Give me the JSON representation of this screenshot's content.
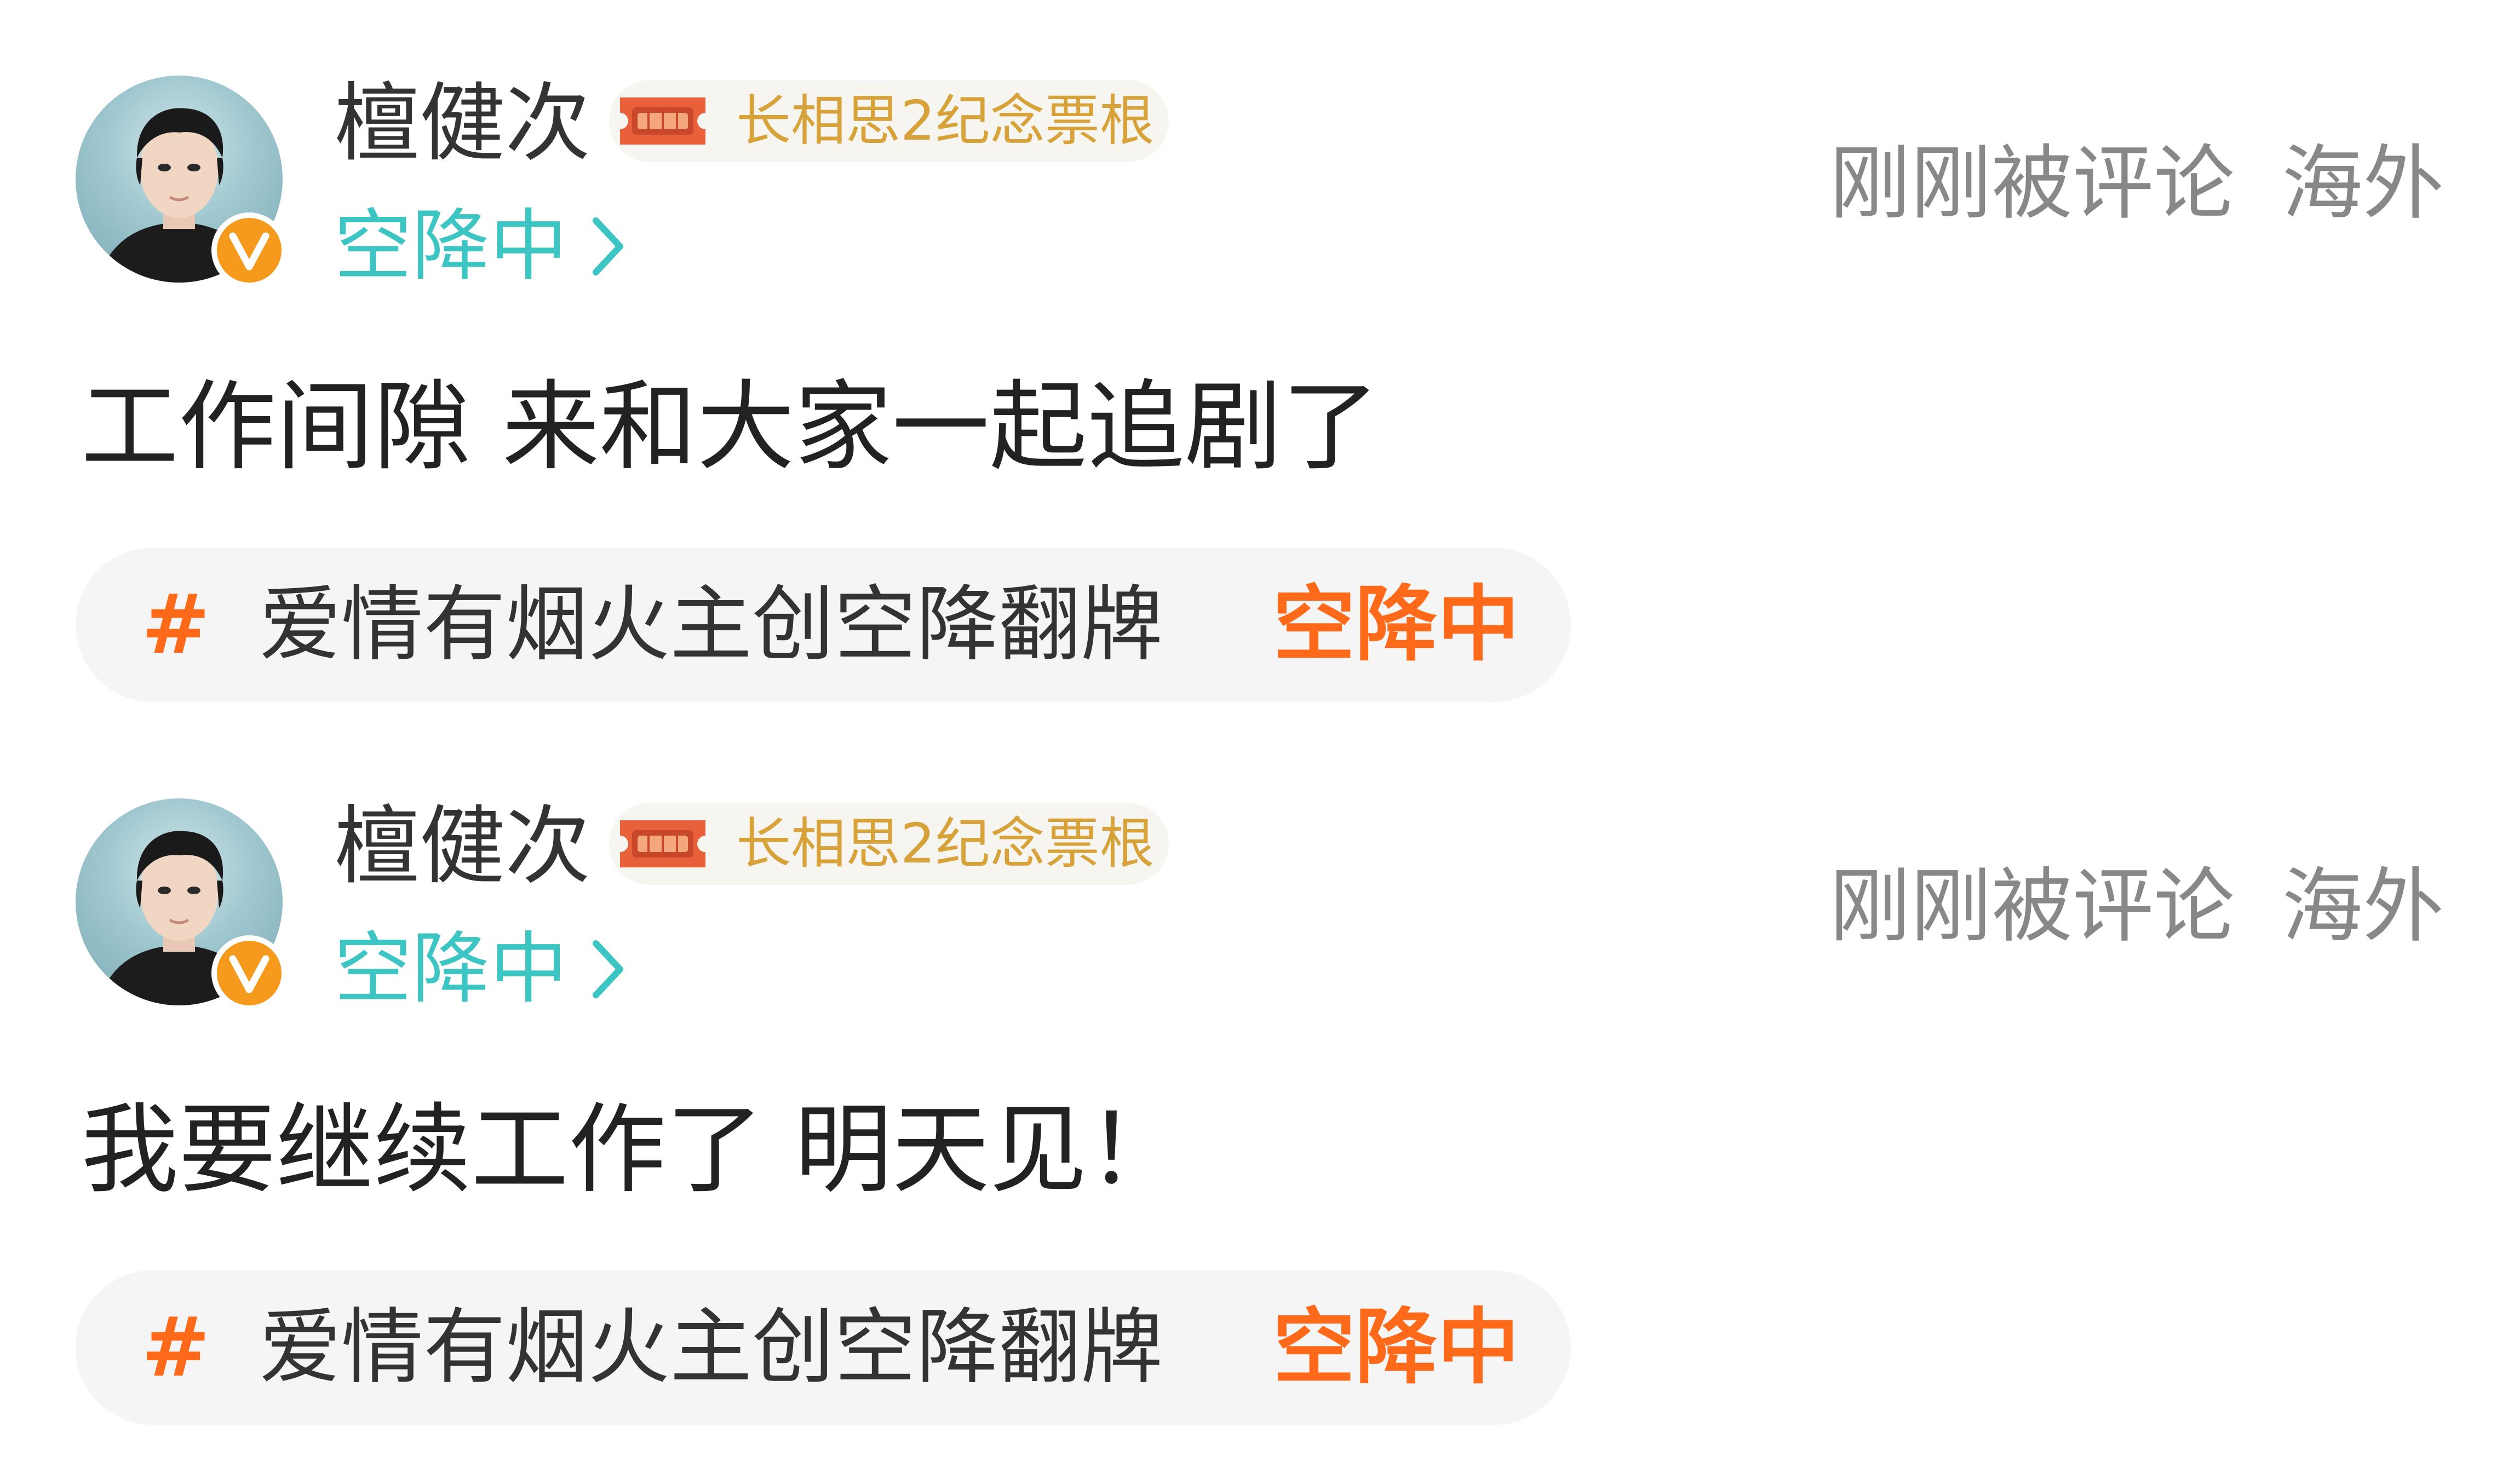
{
  "posts": [
    {
      "username": "檀健次",
      "medal": {
        "label": "长相思2纪念票根",
        "icon": "ticket-icon"
      },
      "status_link": "空降中",
      "meta": {
        "activity": "刚刚被评论",
        "location": "海外"
      },
      "content": "工作间隙 来和大家一起追剧了",
      "topic": {
        "hash": "#",
        "title": "爱情有烟火主创空降翻牌",
        "status": "空降中"
      }
    },
    {
      "username": "檀健次",
      "medal": {
        "label": "长相思2纪念票根",
        "icon": "ticket-icon"
      },
      "status_link": "空降中",
      "meta": {
        "activity": "刚刚被评论",
        "location": "海外"
      },
      "content": "我要继续工作了 明天见！",
      "topic": {
        "hash": "#",
        "title": "爱情有烟火主创空降翻牌",
        "status": "空降中"
      }
    }
  ],
  "colors": {
    "accent_teal": "#3cc5c2",
    "accent_orange": "#ff6a1a",
    "verified_orange": "#f59a1c",
    "medal_gold": "#d7a23a",
    "meta_gray": "#888888"
  }
}
